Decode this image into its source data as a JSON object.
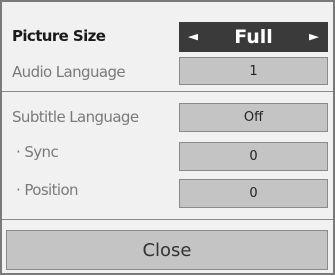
{
  "menu": {
    "picture_size": {
      "label": "Picture Size",
      "value": "Full",
      "arrow_left": "◄",
      "arrow_right": "►"
    },
    "audio_language": {
      "label": "Audio Language",
      "value": "1"
    },
    "subtitle_language": {
      "label": "Subtitle Language",
      "value": "Off"
    },
    "sync": {
      "label": "· Sync",
      "value": "0"
    },
    "position": {
      "label": "· Position",
      "value": "0"
    },
    "close_label": "Close"
  },
  "colors": {
    "selected_bg": "#3a3a3a",
    "value_bg": "#c4c4c4",
    "panel_bg": "#f1f1f1"
  }
}
